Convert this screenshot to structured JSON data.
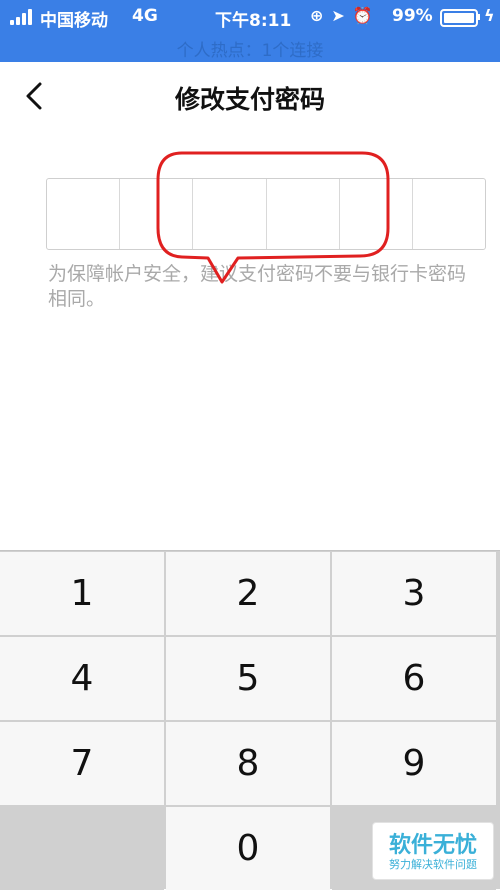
{
  "status_bar": {
    "carrier": "中国移动",
    "network": "4G",
    "time": "下午8:11",
    "icons": [
      "orientation-lock-icon",
      "location-arrow-icon",
      "alarm-icon"
    ],
    "battery_percent": "99%",
    "battery_level": 0.99,
    "charging_icon": "charging-bolt-icon"
  },
  "banner": {
    "text": "个人热点：1个连接"
  },
  "nav": {
    "back_icon": "chevron-left-icon",
    "title": "修改支付密码"
  },
  "pin": {
    "length": 6
  },
  "hint": "为保障帐户安全，建议支付密码不要与银行卡密码相同。",
  "keypad": {
    "keys": [
      "1",
      "2",
      "3",
      "4",
      "5",
      "6",
      "7",
      "8",
      "9",
      "",
      "0",
      ""
    ]
  },
  "watermark": {
    "main": "软件无忧",
    "sub": "努力解决软件问题"
  },
  "colors": {
    "status_bar": "#3a7fe6",
    "annotation": "#e02020",
    "watermark": "#3ab0d8"
  }
}
